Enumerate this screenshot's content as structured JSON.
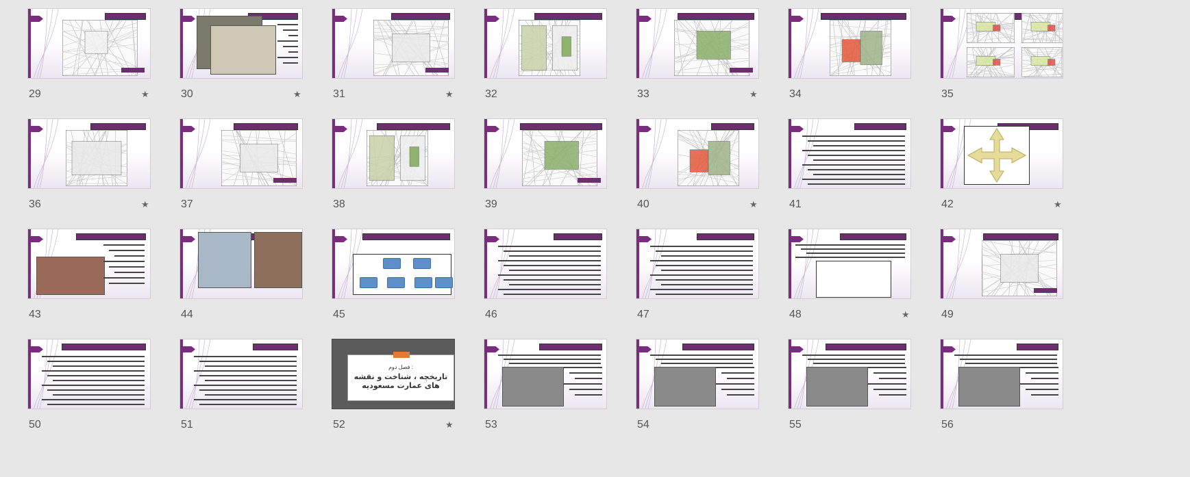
{
  "slides": [
    {
      "number": "29",
      "starred": true,
      "kind": "map"
    },
    {
      "number": "30",
      "starred": true,
      "kind": "photo"
    },
    {
      "number": "31",
      "starred": true,
      "kind": "map"
    },
    {
      "number": "32",
      "starred": false,
      "kind": "map"
    },
    {
      "number": "33",
      "starred": true,
      "kind": "map"
    },
    {
      "number": "34",
      "starred": false,
      "kind": "map"
    },
    {
      "number": "35",
      "starred": false,
      "kind": "multi-map"
    },
    {
      "number": "36",
      "starred": true,
      "kind": "map"
    },
    {
      "number": "37",
      "starred": false,
      "kind": "map"
    },
    {
      "number": "38",
      "starred": false,
      "kind": "map"
    },
    {
      "number": "39",
      "starred": false,
      "kind": "map"
    },
    {
      "number": "40",
      "starred": true,
      "kind": "map"
    },
    {
      "number": "41",
      "starred": false,
      "kind": "text"
    },
    {
      "number": "42",
      "starred": true,
      "kind": "diagram"
    },
    {
      "number": "43",
      "starred": false,
      "kind": "photo"
    },
    {
      "number": "44",
      "starred": false,
      "kind": "photo"
    },
    {
      "number": "45",
      "starred": false,
      "kind": "diagram"
    },
    {
      "number": "46",
      "starred": false,
      "kind": "text"
    },
    {
      "number": "47",
      "starred": false,
      "kind": "text"
    },
    {
      "number": "48",
      "starred": true,
      "kind": "table"
    },
    {
      "number": "49",
      "starred": false,
      "kind": "map"
    },
    {
      "number": "50",
      "starred": false,
      "kind": "text"
    },
    {
      "number": "51",
      "starred": false,
      "kind": "text"
    },
    {
      "number": "52",
      "starred": true,
      "kind": "cover",
      "cover_line1": "فصل دوم :",
      "cover_line2": "تاریخچه ، شناخت و نقشه های عمارت مسعودیه"
    },
    {
      "number": "53",
      "starred": false,
      "kind": "photo"
    },
    {
      "number": "54",
      "starred": false,
      "kind": "photo"
    },
    {
      "number": "55",
      "starred": false,
      "kind": "photo"
    },
    {
      "number": "56",
      "starred": false,
      "kind": "photo"
    }
  ],
  "star_glyph": "★",
  "icons": {
    "star": "star-icon"
  },
  "colors": {
    "accent": "#7a2d7e",
    "background": "#e7e7e7",
    "thumbnail": "#ffffff"
  }
}
